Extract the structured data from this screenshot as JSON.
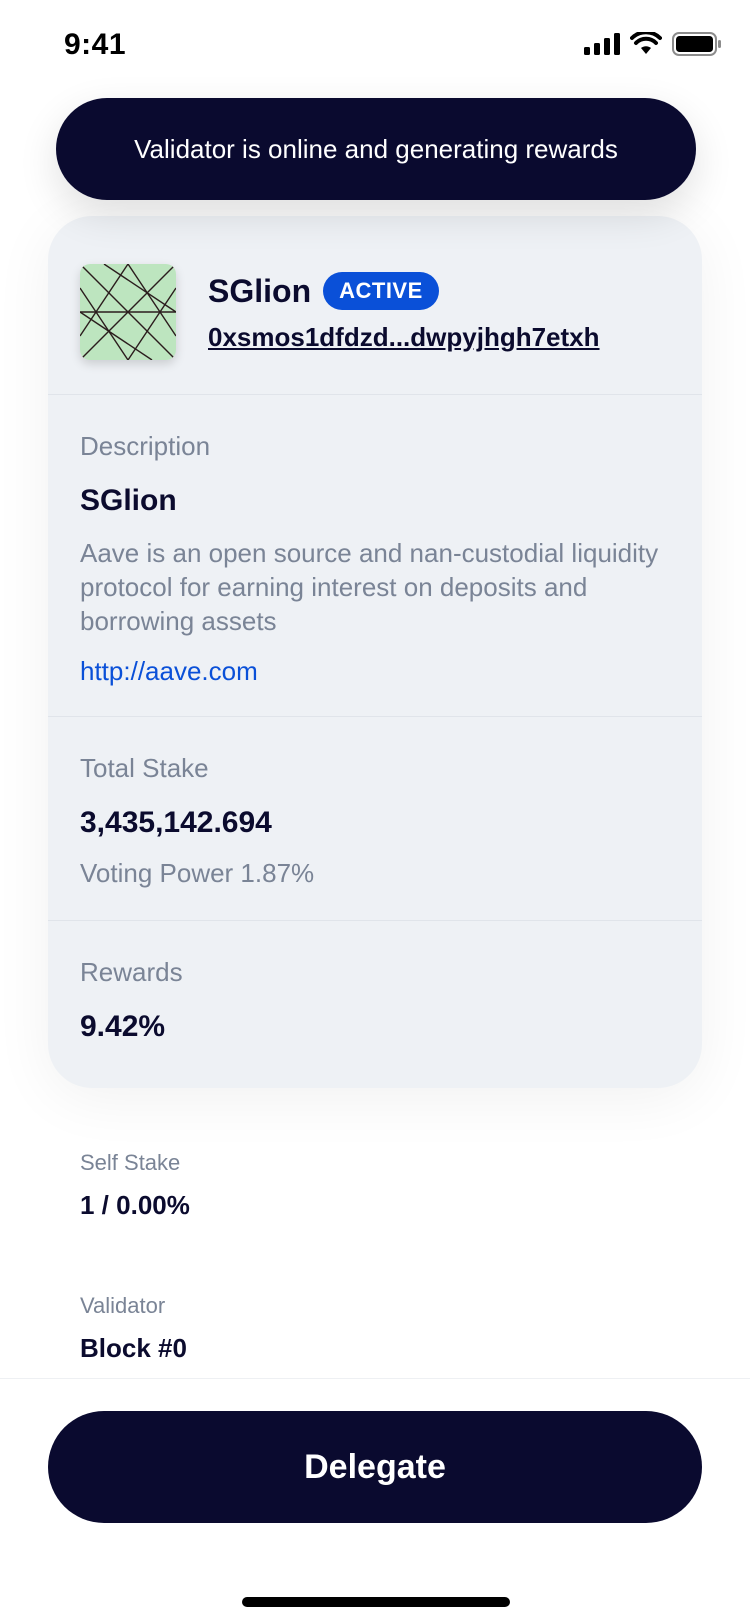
{
  "status_bar": {
    "time": "9:41",
    "icons": [
      "signal-icon",
      "wifi-icon",
      "battery-icon"
    ]
  },
  "toast": {
    "message": "Validator is online and generating rewards"
  },
  "validator": {
    "name": "SGlion",
    "status": "ACTIVE",
    "address": "0xsmos1dfdzd...dwpyjhgh7etxh",
    "avatar_icon": "validator-avatar-pattern"
  },
  "description": {
    "label": "Description",
    "title": "SGlion",
    "text": "Aave is an open source and nan-custodial liquidity protocol for earning interest on deposits and borrowing assets",
    "link": "http://aave.com"
  },
  "total_stake": {
    "label": "Total Stake",
    "value": "3,435,142.694",
    "voting_power": "Voting Power 1.87%"
  },
  "rewards": {
    "label": "Rewards",
    "value": "9.42%"
  },
  "self_stake": {
    "label": "Self Stake",
    "value": "1 / 0.00%"
  },
  "validator_block": {
    "label": "Validator",
    "value": "Block #0"
  },
  "actions": {
    "delegate": "Delegate"
  },
  "colors": {
    "primary": "#0a0a2f",
    "accent": "#0a50d8",
    "card_bg": "#eef1f5",
    "muted": "#7a8496",
    "avatar_bg": "#bde5bf"
  }
}
